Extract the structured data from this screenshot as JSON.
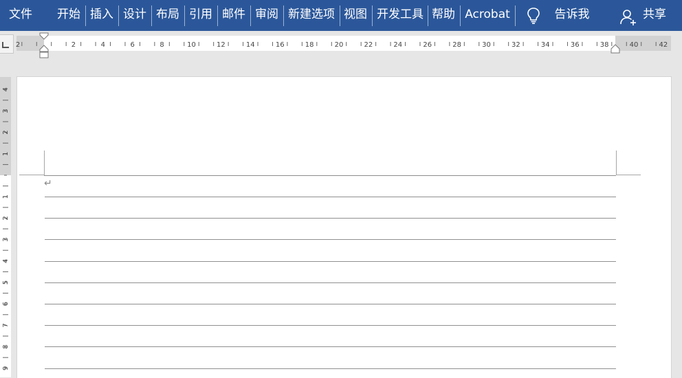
{
  "ribbon": {
    "tabs": [
      {
        "name": "tab-file",
        "label": "文件"
      },
      {
        "name": "tab-home",
        "label": "开始"
      },
      {
        "name": "tab-insert",
        "label": "插入"
      },
      {
        "name": "tab-design",
        "label": "设计"
      },
      {
        "name": "tab-layout",
        "label": "布局"
      },
      {
        "name": "tab-references",
        "label": "引用"
      },
      {
        "name": "tab-mailings",
        "label": "邮件"
      },
      {
        "name": "tab-review",
        "label": "审阅"
      },
      {
        "name": "tab-new-options",
        "label": "新建选项"
      },
      {
        "name": "tab-view",
        "label": "视图"
      },
      {
        "name": "tab-developer",
        "label": "开发工具"
      },
      {
        "name": "tab-help",
        "label": "帮助"
      },
      {
        "name": "tab-acrobat",
        "label": "Acrobat"
      }
    ],
    "tell_me": "告诉我",
    "share": "共享",
    "bulb_icon": "lightbulb-icon",
    "share_icon": "person-add-icon",
    "background_color": "#2b579a"
  },
  "horizontal_ruler": {
    "labels": [
      "2",
      "2",
      "4",
      "6",
      "8",
      "10",
      "12",
      "14",
      "16",
      "18",
      "20",
      "22",
      "24",
      "26",
      "28",
      "30",
      "32",
      "34",
      "36",
      "38",
      "40",
      "42"
    ]
  },
  "vertical_ruler": {
    "labels": [
      "4",
      "3",
      "2",
      "1",
      "1",
      "2",
      "3",
      "4",
      "5",
      "6",
      "7",
      "8",
      "9"
    ]
  },
  "document": {
    "paragraph_mark": "↵",
    "line_count": 9
  }
}
